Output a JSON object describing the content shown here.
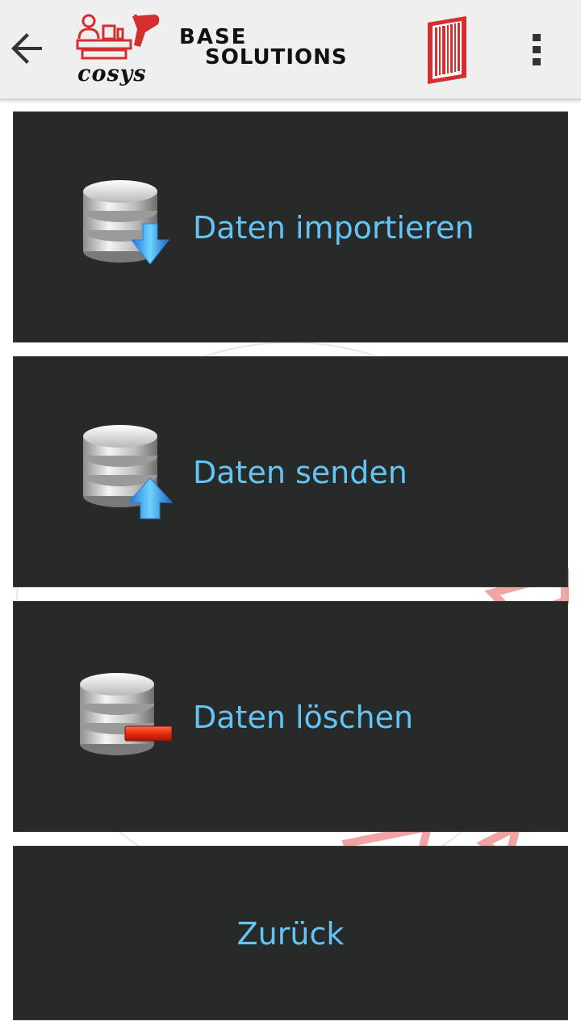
{
  "toolbar": {
    "back_icon": "arrow-left-icon",
    "logo_text": "cosys",
    "brand_line1": "BASE",
    "brand_line2": "SOLUTIONS",
    "barcode_icon": "barcode-icon",
    "overflow_icon": "more-vertical-icon"
  },
  "menu": {
    "items": [
      {
        "label": "Daten importieren",
        "icon": "database-import-icon"
      },
      {
        "label": "Daten senden",
        "icon": "database-upload-icon"
      },
      {
        "label": "Daten löschen",
        "icon": "database-delete-icon"
      },
      {
        "label": "Zurück"
      }
    ]
  },
  "colors": {
    "accent": "#63c4f5",
    "tile_background": "#272a28",
    "brand_red": "#d32f2f"
  }
}
